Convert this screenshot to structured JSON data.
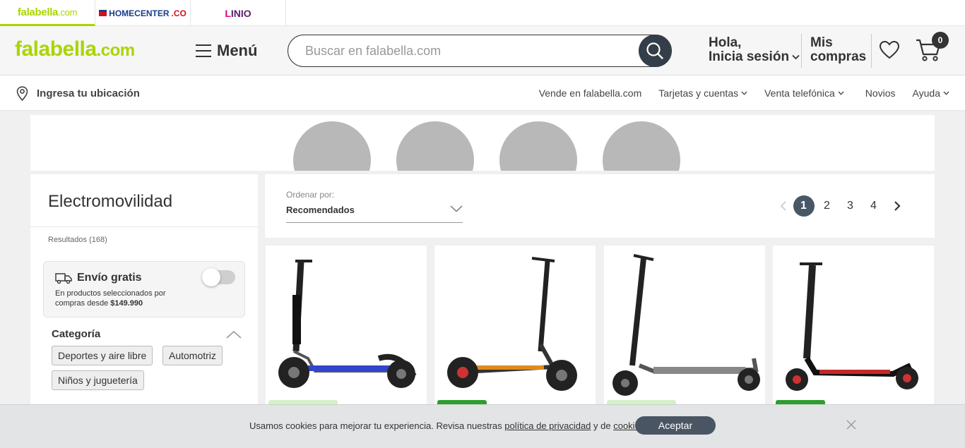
{
  "brands": {
    "falabella": {
      "name": "falabella",
      "suffix": ".com"
    },
    "homecenter": {
      "name": "HOMECENTER",
      "suffix": ".CO"
    },
    "linio": {
      "initial": "L",
      "name": "INIO"
    }
  },
  "header": {
    "logo": {
      "name": "falabella",
      "suffix": ".com"
    },
    "menu_label": "Menú",
    "search_placeholder": "Buscar en falabella.com",
    "greeting": "Hola,",
    "login_label": "Inicia sesión",
    "orders_line1": "Mis",
    "orders_line2": "compras",
    "cart_count": "0"
  },
  "subnav": {
    "location_label": "Ingresa tu ubicación",
    "links": [
      "Vende en falabella.com",
      "Tarjetas y cuentas",
      "Venta telefónica",
      "Novios",
      "Ayuda"
    ]
  },
  "sidebar": {
    "title": "Electromovilidad",
    "results": "Resultados (168)",
    "free_shipping": {
      "title": "Envío gratis",
      "desc_line1": "En productos seleccionados por",
      "desc_line2": "compras desde ",
      "desc_amount": "$149.990",
      "enabled": false
    },
    "category_title": "Categoría",
    "chips": [
      "Deportes y aire libre",
      "Automotriz",
      "Niños y juguetería"
    ]
  },
  "sort": {
    "label": "Ordenar por:",
    "value": "Recomendados"
  },
  "pagination": {
    "pages": [
      "1",
      "2",
      "3",
      "4"
    ],
    "current": "1"
  },
  "cookie": {
    "text_before": "Usamos cookies para mejorar tu experiencia. Revisa nuestras ",
    "privacy_link": "política de privacidad",
    "text_middle": " y de ",
    "cookies_link": "cookies",
    "text_end": ".",
    "accept_label": "Aceptar"
  },
  "colors": {
    "brand_green": "#aad500",
    "dark": "#343e48",
    "badge_green": "#2e9e2e"
  }
}
